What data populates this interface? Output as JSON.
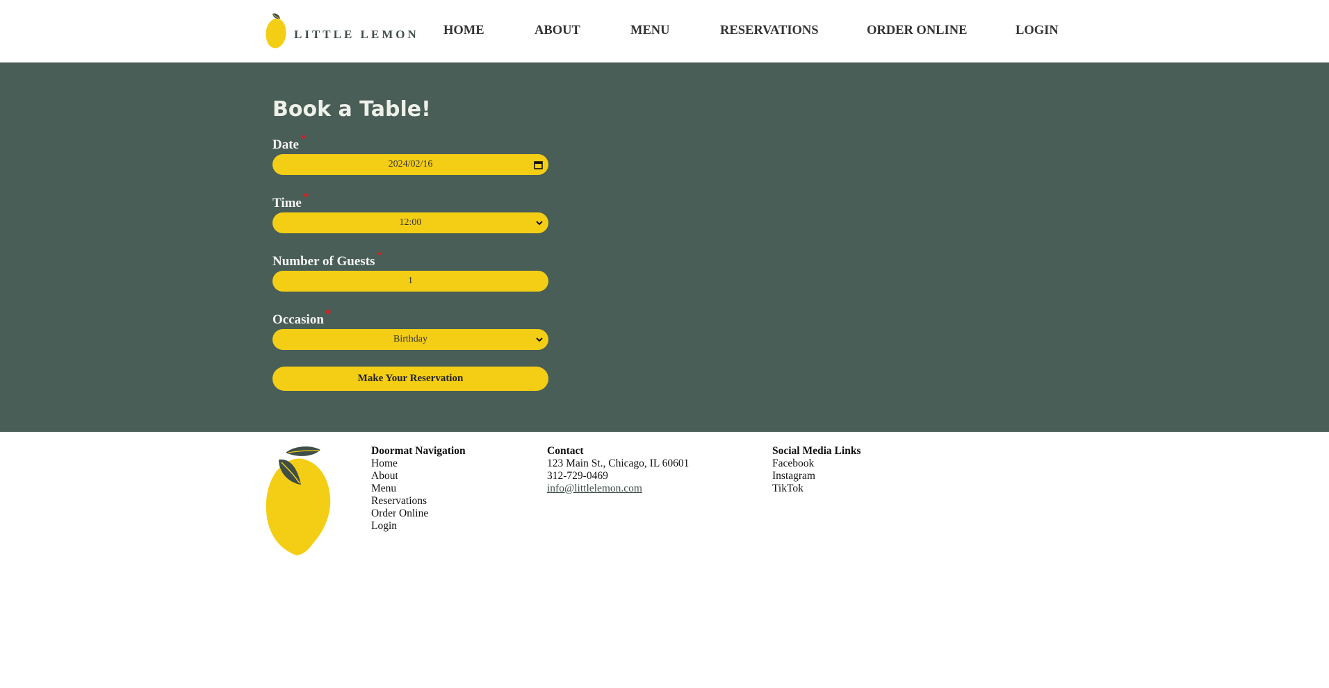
{
  "header": {
    "logo_text": "LITTLE LEMON",
    "nav": [
      "HOME",
      "ABOUT",
      "MENU",
      "RESERVATIONS",
      "ORDER ONLINE",
      "LOGIN"
    ]
  },
  "form": {
    "title": "Book a Table!",
    "date": {
      "label": "Date",
      "value": "2024/02/16"
    },
    "time": {
      "label": "Time",
      "value": "12:00"
    },
    "guests": {
      "label": "Number of Guests",
      "value": "1"
    },
    "occasion": {
      "label": "Occasion",
      "value": "Birthday"
    },
    "required_mark": "*",
    "submit_label": "Make Your Reservation"
  },
  "footer": {
    "nav": {
      "heading": "Doormat Navigation",
      "items": [
        "Home",
        "About",
        "Menu",
        "Reservations",
        "Order Online",
        "Login"
      ]
    },
    "contact": {
      "heading": "Contact",
      "address": "123 Main St., Chicago, IL 60601",
      "phone": "312-729-0469",
      "email": "info@littlelemon.com"
    },
    "social": {
      "heading": "Social Media Links",
      "items": [
        "Facebook",
        "Instagram",
        "TikTok"
      ]
    }
  },
  "colors": {
    "primary_green": "#495e57",
    "primary_yellow": "#f4ce14",
    "required": "#e01c1c"
  }
}
